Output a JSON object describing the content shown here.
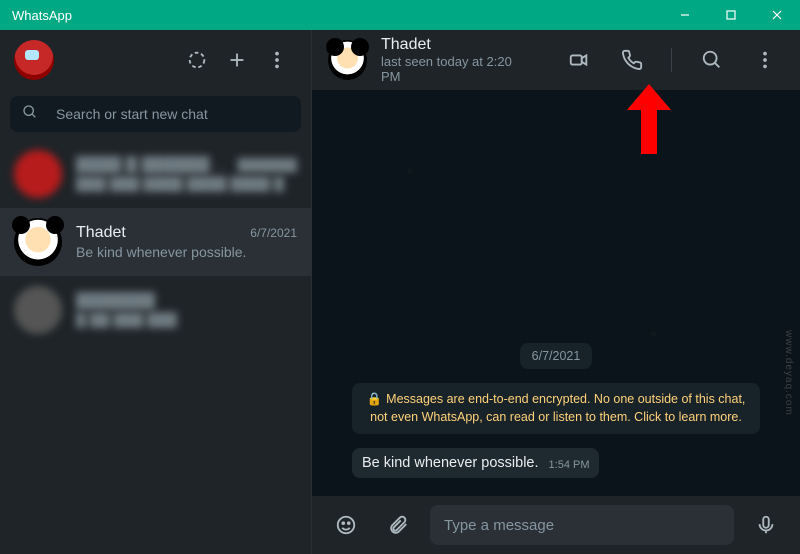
{
  "window": {
    "title": "WhatsApp"
  },
  "sidebar": {
    "search_placeholder": "Search or start new chat",
    "items": [
      {
        "name": "████ █ ████████",
        "preview": "███ ███ ████ ████ ████ █",
        "date": "███████",
        "blurred": true
      },
      {
        "name": "Thadet",
        "preview": "Be kind whenever possible.",
        "date": "6/7/2021",
        "selected": true
      },
      {
        "name": "███████",
        "preview": "█ ██ ███ ███",
        "date": "",
        "blurred": true
      }
    ]
  },
  "chat": {
    "contact_name": "Thadet",
    "status": "last seen today at 2:20 PM",
    "date_separator": "6/7/2021",
    "encryption_notice": "Messages are end-to-end encrypted. No one outside of this chat, not even WhatsApp, can read or listen to them. Click to learn more.",
    "messages": [
      {
        "direction": "in",
        "text": "Be kind whenever possible.",
        "time": "1:54 PM"
      }
    ]
  },
  "composer": {
    "placeholder": "Type a message"
  },
  "watermark": "www.deyaq.com"
}
